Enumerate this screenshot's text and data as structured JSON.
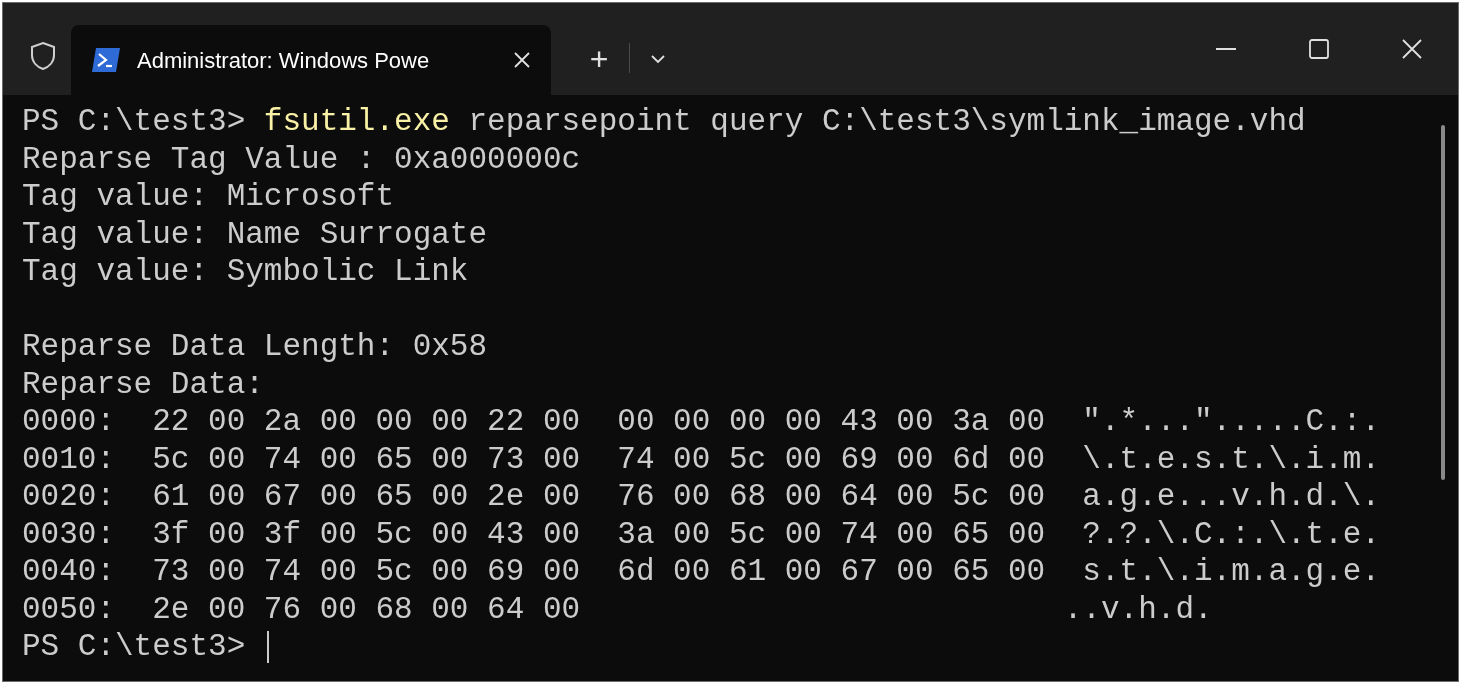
{
  "window": {
    "tab_title": "Administrator: Windows Powe",
    "new_tab": "+"
  },
  "terminal": {
    "lines": [
      {
        "kind": "command",
        "prompt": "PS C:\\test3>",
        "command": "fsutil.exe",
        "args": "reparsepoint query C:\\test3\\symlink_image.vhd"
      },
      {
        "kind": "output",
        "text": "Reparse Tag Value : 0xa000000c"
      },
      {
        "kind": "output",
        "text": "Tag value: Microsoft"
      },
      {
        "kind": "output",
        "text": "Tag value: Name Surrogate"
      },
      {
        "kind": "output",
        "text": "Tag value: Symbolic Link"
      },
      {
        "kind": "blank"
      },
      {
        "kind": "output",
        "text": "Reparse Data Length: 0x58"
      },
      {
        "kind": "output",
        "text": "Reparse Data:"
      },
      {
        "kind": "output",
        "text": "0000:  22 00 2a 00 00 00 22 00  00 00 00 00 43 00 3a 00  \".*...\".....C.:."
      },
      {
        "kind": "output",
        "text": "0010:  5c 00 74 00 65 00 73 00  74 00 5c 00 69 00 6d 00  \\.t.e.s.t.\\.i.m."
      },
      {
        "kind": "output",
        "text": "0020:  61 00 67 00 65 00 2e 00  76 00 68 00 64 00 5c 00  a.g.e...v.h.d.\\."
      },
      {
        "kind": "output",
        "text": "0030:  3f 00 3f 00 5c 00 43 00  3a 00 5c 00 74 00 65 00  ?.?.\\.C.:.\\.t.e."
      },
      {
        "kind": "output",
        "text": "0040:  73 00 74 00 5c 00 69 00  6d 00 61 00 67 00 65 00  s.t.\\.i.m.a.g.e."
      },
      {
        "kind": "output",
        "text": "0050:  2e 00 76 00 68 00 64 00                          ..v.h.d."
      },
      {
        "kind": "prompt",
        "prompt": "PS C:\\test3>"
      }
    ]
  }
}
